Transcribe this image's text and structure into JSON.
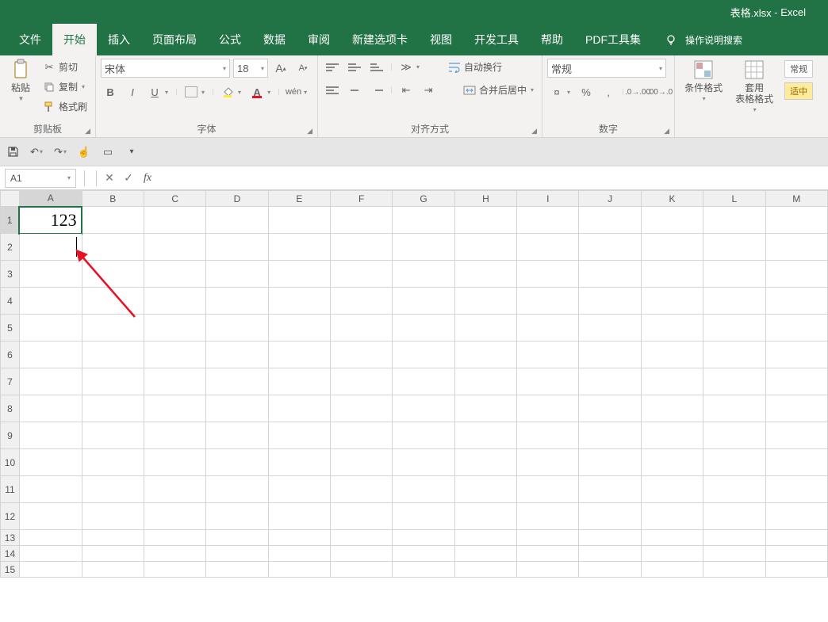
{
  "title_bar": {
    "doc": "表格.xlsx",
    "app": "Excel",
    "sep": "-"
  },
  "menu": {
    "tabs": [
      "文件",
      "开始",
      "插入",
      "页面布局",
      "公式",
      "数据",
      "审阅",
      "新建选项卡",
      "视图",
      "开发工具",
      "帮助",
      "PDF工具集"
    ],
    "active_index": 1,
    "tell_me": "操作说明搜索"
  },
  "ribbon": {
    "clipboard": {
      "paste": "粘贴",
      "cut": "剪切",
      "copy": "复制",
      "format_painter": "格式刷",
      "group": "剪贴板"
    },
    "font": {
      "name": "宋体",
      "size": "18",
      "bold": "B",
      "italic": "I",
      "underline": "U",
      "group": "字体"
    },
    "alignment": {
      "wrap": "自动换行",
      "merge": "合并后居中",
      "group": "对齐方式"
    },
    "number": {
      "format": "常规",
      "percent": "%",
      "comma": ",",
      "group": "数字"
    },
    "styles": {
      "cond": "条件格式",
      "table": "套用\n表格格式",
      "cell_styles_a": "常规",
      "cell_styles_b": "适中"
    }
  },
  "qat": {
    "items": [
      "save",
      "undo",
      "redo",
      "touch",
      "preview",
      "more"
    ]
  },
  "formula_bar": {
    "name_box": "A1",
    "fx": "fx",
    "value": ""
  },
  "grid": {
    "columns": [
      "A",
      "B",
      "C",
      "D",
      "E",
      "F",
      "G",
      "H",
      "I",
      "J",
      "K",
      "L",
      "M"
    ],
    "row_count": 15,
    "tall_rows": 12,
    "active_cell": "A1",
    "cells": {
      "A1": "123"
    }
  }
}
